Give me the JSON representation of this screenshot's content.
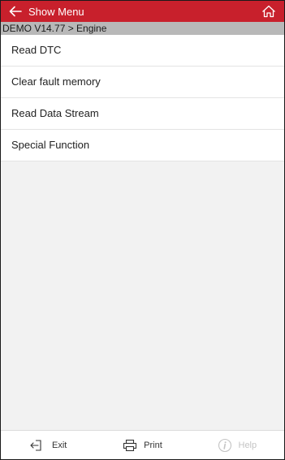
{
  "appbar": {
    "title": "Show Menu",
    "back_icon": "arrow-left-icon",
    "home_icon": "home-icon"
  },
  "breadcrumb": "DEMO V14.77 > Engine",
  "menu": {
    "items": [
      {
        "label": "Read DTC"
      },
      {
        "label": "Clear fault memory"
      },
      {
        "label": "Read Data Stream"
      },
      {
        "label": "Special Function"
      }
    ]
  },
  "bottom": {
    "exit_label": "Exit",
    "print_label": "Print",
    "help_label": "Help",
    "help_enabled": false
  },
  "colors": {
    "accent": "#c8202c",
    "breadcrumb_bg": "#b8b8b8",
    "disabled": "#c4c4c4"
  }
}
